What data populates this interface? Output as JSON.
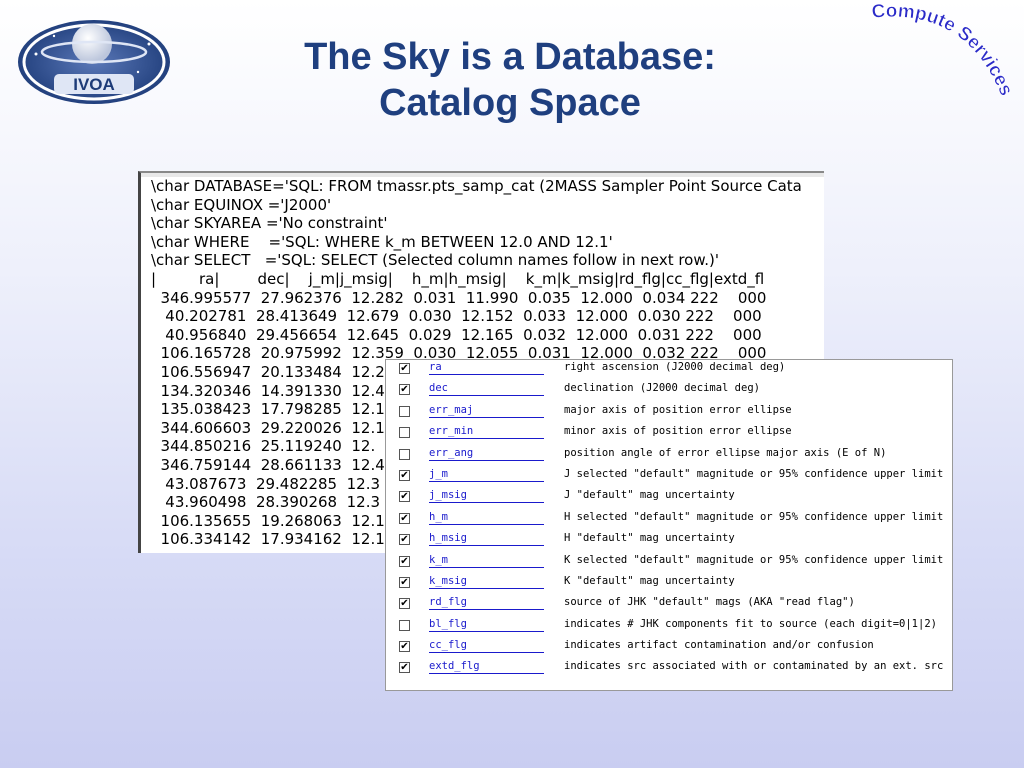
{
  "slide": {
    "title_line1": "The Sky is a Database:",
    "title_line2": "Catalog Space",
    "logo_text": "IVOA",
    "badge_text": "Compute Services"
  },
  "sql_panel": {
    "lines": [
      "\\char DATABASE='SQL: FROM tmassr.pts_samp_cat (2MASS Sampler Point Source Cata",
      "\\char EQUINOX ='J2000'",
      "\\char SKYAREA ='No constraint'",
      "\\char WHERE    ='SQL: WHERE k_m BETWEEN 12.0 AND 12.1'",
      "\\char SELECT   ='SQL: SELECT (Selected column names follow in next row.)'",
      "|         ra|        dec|    j_m|j_msig|    h_m|h_msig|    k_m|k_msig|rd_flg|cc_flg|extd_fl",
      "  346.995577  27.962376  12.282  0.031  11.990  0.035  12.000  0.034 222    000",
      "   40.202781  28.413649  12.679  0.030  12.152  0.033  12.000  0.030 222    000",
      "   40.956840  29.456654  12.645  0.029  12.165  0.032  12.000  0.031 222    000",
      "  106.165728  20.975992  12.359  0.030  12.055  0.031  12.000  0.032 222    000",
      "  106.556947  20.133484  12.2",
      "  134.320346  14.391330  12.4",
      "  135.038423  17.798285  12.1",
      "  344.606603  29.220026  12.1",
      "  344.850216  25.119240  12.",
      "  346.759144  28.661133  12.4",
      "   43.087673  29.482285  12.3",
      "   43.960498  28.390268  12.3",
      "  106.135655  19.268063  12.1",
      "  106.334142  17.934162  12.1"
    ]
  },
  "columns_panel": {
    "rows": [
      {
        "checked": true,
        "check_mark": "✔",
        "name": "ra",
        "desc": "right ascension (J2000 decimal deg)"
      },
      {
        "checked": true,
        "check_mark": "✔",
        "name": "dec",
        "desc": "declination (J2000 decimal deg)"
      },
      {
        "checked": false,
        "check_mark": "",
        "name": "err_maj",
        "desc": "major axis of position error ellipse"
      },
      {
        "checked": false,
        "check_mark": "",
        "name": "err_min",
        "desc": "minor axis of position error ellipse"
      },
      {
        "checked": false,
        "check_mark": "",
        "name": "err_ang",
        "desc": "position angle of error ellipse major axis (E of N)"
      },
      {
        "checked": true,
        "check_mark": "✔",
        "name": "j_m",
        "desc": "J selected \"default\" magnitude or 95% confidence upper limit"
      },
      {
        "checked": true,
        "check_mark": "✔",
        "name": "j_msig",
        "desc": "J \"default\" mag uncertainty"
      },
      {
        "checked": true,
        "check_mark": "✔",
        "name": "h_m",
        "desc": "H selected \"default\" magnitude or 95% confidence upper limit"
      },
      {
        "checked": true,
        "check_mark": "✔",
        "name": "h_msig",
        "desc": "H \"default\" mag uncertainty"
      },
      {
        "checked": true,
        "check_mark": "✔",
        "name": "k_m",
        "desc": "K selected \"default\" magnitude or 95% confidence upper limit"
      },
      {
        "checked": true,
        "check_mark": "✔",
        "name": "k_msig",
        "desc": "K \"default\" mag uncertainty"
      },
      {
        "checked": true,
        "check_mark": "✔",
        "name": "rd_flg",
        "desc": "source of JHK \"default\" mags (AKA \"read flag\")"
      },
      {
        "checked": false,
        "check_mark": "",
        "name": "bl_flg",
        "desc": "indicates # JHK components fit to source (each digit=0|1|2)"
      },
      {
        "checked": true,
        "check_mark": "✔",
        "name": "cc_flg",
        "desc": "indicates artifact contamination and/or confusion"
      },
      {
        "checked": true,
        "check_mark": "✔",
        "name": "extd_flg",
        "desc": "indicates src associated with or contaminated by an ext. src"
      }
    ]
  },
  "colors": {
    "title": "#1f3f7f",
    "badge": "#2a2ac8",
    "link": "#1a1acc",
    "logo_dark": "#1d3b78"
  }
}
